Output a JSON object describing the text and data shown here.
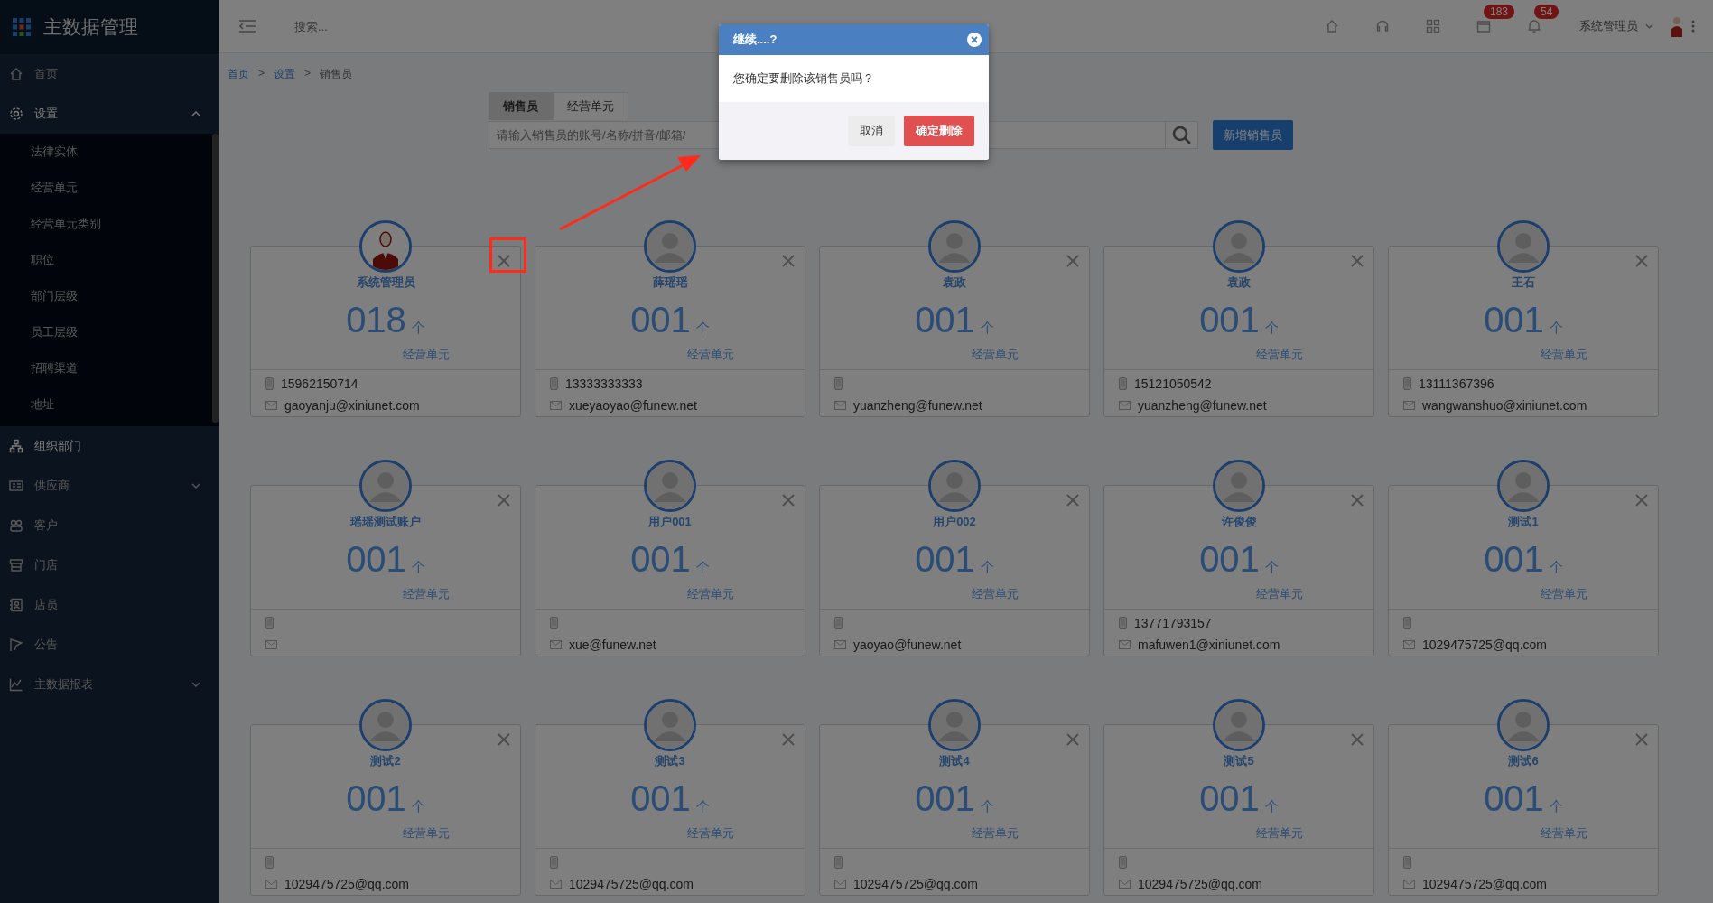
{
  "sidebar": {
    "title": "主数据管理",
    "items": [
      {
        "label": "首页",
        "kind": "home",
        "selected": false
      },
      {
        "label": "设置",
        "kind": "gear",
        "selected": true,
        "expanded": true,
        "children": [
          {
            "label": "法律实体"
          },
          {
            "label": "经营单元"
          },
          {
            "label": "经营单元类别"
          },
          {
            "label": "职位"
          },
          {
            "label": "部门层级"
          },
          {
            "label": "员工层级"
          },
          {
            "label": "招聘渠道"
          },
          {
            "label": "地址"
          }
        ]
      },
      {
        "label": "组织部门",
        "kind": "org",
        "selected": true
      },
      {
        "label": "供应商",
        "kind": "card",
        "selected": false,
        "expanded": false
      },
      {
        "label": "客户",
        "kind": "people",
        "selected": false
      },
      {
        "label": "门店",
        "kind": "store",
        "selected": false
      },
      {
        "label": "店员",
        "kind": "badge",
        "selected": false
      },
      {
        "label": "公告",
        "kind": "flag",
        "selected": false
      },
      {
        "label": "主数据报表",
        "kind": "chart",
        "selected": false,
        "expanded": false
      }
    ]
  },
  "topbar": {
    "search": {
      "placeholder": "搜索..."
    },
    "icons": [
      {
        "kind": "home"
      },
      {
        "kind": "headset"
      },
      {
        "kind": "grid"
      },
      {
        "kind": "box",
        "badge": "183"
      },
      {
        "kind": "bell",
        "badge": "54"
      }
    ],
    "user": {
      "name": "系统管理员"
    }
  },
  "breadcrumb": {
    "separator": ">",
    "items": [
      {
        "label": "首页",
        "link": true
      },
      {
        "label": "设置",
        "link": true
      },
      {
        "label": "销售员",
        "link": false
      }
    ]
  },
  "tabs": [
    {
      "label": "销售员",
      "selected": true
    },
    {
      "label": "经营单元",
      "selected": false
    }
  ],
  "search": {
    "placeholder": "请输入销售员的账号/名称/拼音/邮箱/"
  },
  "add_button": "新增销售员",
  "cards": [
    {
      "name": "系统管理员",
      "kind": "custom",
      "count": "018",
      "unit": "个",
      "label": "经营单元",
      "phone": "15962150714",
      "email": "gaoyanju@xiniunet.com",
      "highlighted": true
    },
    {
      "name": "薛瑶瑶",
      "kind": "default",
      "count": "001",
      "unit": "个",
      "label": "经营单元",
      "phone": "13333333333",
      "email": "xueyaoyao@funew.net",
      "highlighted": false
    },
    {
      "name": "袁政",
      "kind": "default",
      "count": "001",
      "unit": "个",
      "label": "经营单元",
      "email": "yuanzheng@funew.net",
      "highlighted": false
    },
    {
      "name": "袁政",
      "kind": "default",
      "count": "001",
      "unit": "个",
      "label": "经营单元",
      "phone": "15121050542",
      "email": "yuanzheng@funew.net",
      "highlighted": false
    },
    {
      "name": "王石",
      "kind": "default",
      "count": "001",
      "unit": "个",
      "label": "经营单元",
      "phone": "13111367396",
      "email": "wangwanshuo@xiniunet.com",
      "highlighted": false
    },
    {
      "name": "瑶瑶测试账户",
      "kind": "default",
      "count": "001",
      "unit": "个",
      "label": "经营单元",
      "highlighted": false
    },
    {
      "name": "用户001",
      "kind": "default",
      "count": "001",
      "unit": "个",
      "label": "经营单元",
      "email": "xue@funew.net",
      "highlighted": false
    },
    {
      "name": "用户002",
      "kind": "default",
      "count": "001",
      "unit": "个",
      "label": "经营单元",
      "email": "yaoyao@funew.net",
      "highlighted": false
    },
    {
      "name": "许俊俊",
      "kind": "default",
      "count": "001",
      "unit": "个",
      "label": "经营单元",
      "phone": "13771793157",
      "email": "mafuwen1@xiniunet.com",
      "highlighted": false
    },
    {
      "name": "测试1",
      "kind": "default",
      "count": "001",
      "unit": "个",
      "label": "经营单元",
      "email": "1029475725@qq.com",
      "highlighted": false
    },
    {
      "name": "测试2",
      "kind": "default",
      "count": "001",
      "unit": "个",
      "label": "经营单元",
      "email": "1029475725@qq.com",
      "highlighted": false
    },
    {
      "name": "测试3",
      "kind": "default",
      "count": "001",
      "unit": "个",
      "label": "经营单元",
      "email": "1029475725@qq.com",
      "highlighted": false
    },
    {
      "name": "测试4",
      "kind": "default",
      "count": "001",
      "unit": "个",
      "label": "经营单元",
      "email": "1029475725@qq.com",
      "highlighted": false
    },
    {
      "name": "测试5",
      "kind": "default",
      "count": "001",
      "unit": "个",
      "label": "经营单元",
      "email": "1029475725@qq.com",
      "highlighted": false
    },
    {
      "name": "测试6",
      "kind": "default",
      "count": "001",
      "unit": "个",
      "label": "经营单元",
      "email": "1029475725@qq.com",
      "highlighted": false
    }
  ],
  "dialog": {
    "title": "继续....?",
    "message": "您确定要删除该销售员吗？",
    "buttons": [
      {
        "label": "取消",
        "kind": "cancel"
      },
      {
        "label": "确定删除",
        "kind": "danger"
      }
    ]
  }
}
